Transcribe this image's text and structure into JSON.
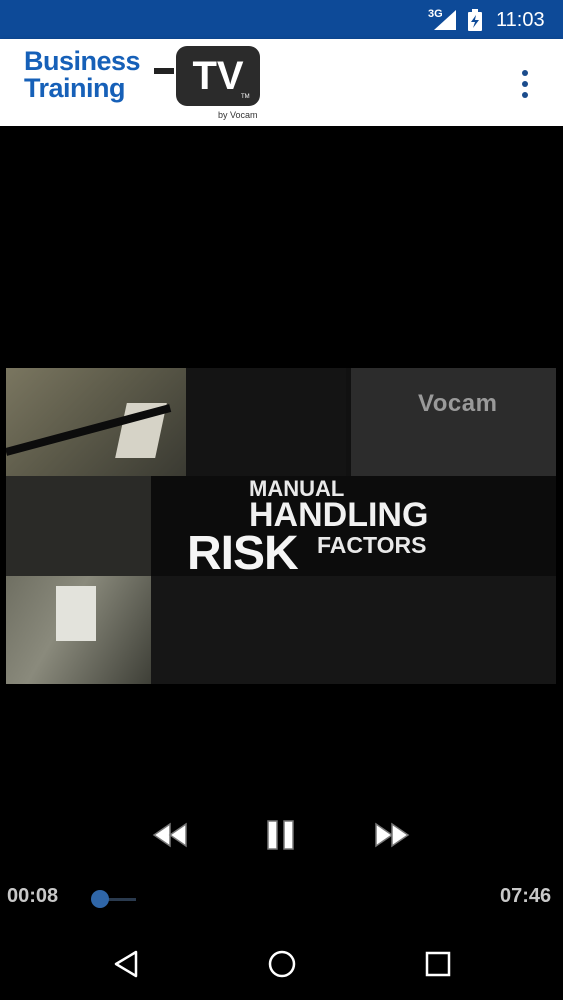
{
  "status_bar": {
    "network": "3G",
    "time": "11:03",
    "icons": [
      "signal-icon",
      "battery-charging-icon"
    ]
  },
  "app_bar": {
    "logo_line1": "Business",
    "logo_line2": "Training",
    "logo_tv": "TV",
    "logo_tm": "TM",
    "logo_by": "by Vocam",
    "menu_icon": "overflow-menu-icon"
  },
  "video": {
    "watermark": "Vocam",
    "title_line1": "MANUAL",
    "title_line2": "HANDLING",
    "title_line3": "RISK",
    "title_line4": "FACTORS"
  },
  "controls": {
    "rewind_icon": "rewind-icon",
    "pause_icon": "pause-icon",
    "fast_forward_icon": "fast-forward-icon",
    "current_time": "00:08",
    "total_time": "07:46",
    "progress_fraction": 0.017
  },
  "nav_bar": {
    "icons": [
      "back-icon",
      "home-icon",
      "recents-icon"
    ]
  },
  "colors": {
    "status_bar": "#0d4a98",
    "brand_blue": "#1660b8",
    "seek_thumb": "#2f66a8"
  }
}
